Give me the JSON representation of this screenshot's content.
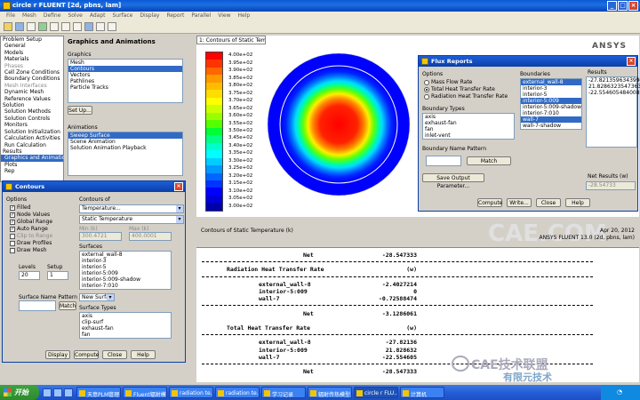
{
  "window": {
    "title": "circle r FLUENT [2d, pbns, lam]"
  },
  "menu": [
    "File",
    "Mesh",
    "Define",
    "Solve",
    "Adapt",
    "Surface",
    "Display",
    "Report",
    "Parallel",
    "View",
    "Help"
  ],
  "nav": {
    "items": [
      {
        "label": "Problem Setup",
        "type": "h"
      },
      {
        "label": "General"
      },
      {
        "label": "Models"
      },
      {
        "label": "Materials"
      },
      {
        "label": "Phases",
        "type": "dis"
      },
      {
        "label": "Cell Zone Conditions"
      },
      {
        "label": "Boundary Conditions"
      },
      {
        "label": "Mesh Interfaces",
        "type": "dis"
      },
      {
        "label": "Dynamic Mesh"
      },
      {
        "label": "Reference Values"
      },
      {
        "label": "Solution",
        "type": "h"
      },
      {
        "label": "Solution Methods"
      },
      {
        "label": "Solution Controls"
      },
      {
        "label": "Monitors"
      },
      {
        "label": "Solution Initialization"
      },
      {
        "label": "Calculation Activities"
      },
      {
        "label": "Run Calculation"
      },
      {
        "label": "Results",
        "type": "h"
      },
      {
        "label": "Graphics and Animations",
        "type": "sel"
      },
      {
        "label": "Plots"
      },
      {
        "label": "Rep"
      }
    ]
  },
  "graphics_panel": {
    "title": "Graphics and Animations",
    "graphics_label": "Graphics",
    "graphics_items": [
      "Mesh",
      "Contours",
      "Vectors",
      "Pathlines",
      "Particle Tracks"
    ],
    "graphics_selected": 1,
    "setup_button": "Set Up...",
    "animations_label": "Animations",
    "animation_items": [
      "Sweep Surface",
      "Scene Animation",
      "Solution Animation Playback"
    ],
    "animation_selected": 0
  },
  "graphics_window": {
    "tab": "1: Contours of Static Temper",
    "brand": "ANSYS",
    "scale_values": [
      "4.00e+02",
      "3.95e+02",
      "3.90e+02",
      "3.85e+02",
      "3.80e+02",
      "3.75e+02",
      "3.70e+02",
      "3.65e+02",
      "3.60e+02",
      "3.55e+02",
      "3.50e+02",
      "3.45e+02",
      "3.40e+02",
      "3.35e+02",
      "3.30e+02",
      "3.25e+02",
      "3.20e+02",
      "3.15e+02",
      "3.10e+02",
      "3.05e+02",
      "3.00e+02"
    ],
    "scale_colors": [
      "#ff0000",
      "#ff3300",
      "#ff6600",
      "#ff9900",
      "#ffbb00",
      "#ffdd00",
      "#ffff00",
      "#ccff00",
      "#99ff00",
      "#55ff00",
      "#00ff33",
      "#00ff88",
      "#00ffcc",
      "#00ffff",
      "#00ccff",
      "#0099ff",
      "#0066ff",
      "#0033ff",
      "#0000ff",
      "#0000dd",
      "#0000aa"
    ],
    "watermark": "CAE.COM",
    "caption": "Contours of Static Temperature (k)",
    "date": "Apr 20, 2012",
    "version": "ANSYS FLUENT 13.0 (2d, pbns, lam)"
  },
  "console": [
    {
      "l": "Net",
      "r": "-28.547333",
      "kind": "row"
    },
    {
      "kind": "dash"
    },
    {
      "l": "Radiation Heat Transfer Rate",
      "r": "(w)",
      "kind": "head"
    },
    {
      "kind": "dash"
    },
    {
      "l": "external_wall-8",
      "r": "-2.4027214",
      "kind": "row"
    },
    {
      "l": "interior-5:009",
      "r": "0",
      "kind": "row"
    },
    {
      "l": "wall-7",
      "r": "-0.72588474",
      "kind": "row"
    },
    {
      "kind": "dash"
    },
    {
      "l": "Net",
      "r": "-3.1286061",
      "kind": "row"
    },
    {
      "kind": "blank"
    },
    {
      "l": "Total Heat Transfer Rate",
      "r": "(w)",
      "kind": "head"
    },
    {
      "kind": "dash"
    },
    {
      "l": "external_wall-8",
      "r": "-27.82136",
      "kind": "row"
    },
    {
      "l": "interior-5:009",
      "r": "21.828632",
      "kind": "row"
    },
    {
      "l": "wall-7",
      "r": "-22.554605",
      "kind": "row"
    },
    {
      "kind": "dash"
    },
    {
      "l": "Net",
      "r": "-28.547333",
      "kind": "row"
    }
  ],
  "flux": {
    "title": "Flux Reports",
    "options_label": "Options",
    "options": [
      "Mass Flow Rate",
      "Total Heat Transfer Rate",
      "Radiation Heat Transfer Rate"
    ],
    "option_selected": 1,
    "boundary_types_label": "Boundary Types",
    "boundary_types": [
      "axis",
      "exhaust-fan",
      "fan",
      "inlet-vent"
    ],
    "boundaries_label": "Boundaries",
    "boundaries": [
      "external_wall-8",
      "interior-3",
      "interior-5",
      "interior-5:009",
      "interior-5:009-shadow",
      "interior-7:010",
      "wall-7",
      "wall-7-shadow"
    ],
    "boundaries_selected": [
      0,
      3,
      6
    ],
    "results_label": "Results",
    "results": [
      "-27.82135963439941",
      "21.82863235473633",
      "-22.55460548400879"
    ],
    "pattern_label": "Boundary Name Pattern",
    "match": "Match",
    "save_output": "Save Output Parameter...",
    "net_label": "Net Results (w)",
    "net_value": "-28.54733",
    "buttons": [
      "Compute",
      "Write...",
      "Close",
      "Help"
    ]
  },
  "contours": {
    "title": "Contours",
    "options_label": "Options",
    "options": [
      {
        "label": "Filled",
        "checked": true
      },
      {
        "label": "Node Values",
        "checked": true
      },
      {
        "label": "Global Range",
        "checked": true
      },
      {
        "label": "Auto Range",
        "checked": true
      },
      {
        "label": "Clip to Range",
        "checked": false,
        "disabled": true
      },
      {
        "label": "Draw Profiles",
        "checked": false
      },
      {
        "label": "Draw Mesh",
        "checked": false
      }
    ],
    "contours_of_label": "Contours of",
    "contours_of": "Temperature...",
    "contours_sub": "Static Temperature",
    "min_label": "Min (k)",
    "min_value": "300.4721",
    "max_label": "Max (k)",
    "max_value": "400.0001",
    "levels_label": "Levels",
    "levels": "20",
    "setup_label": "Setup",
    "setup": "1",
    "surfaces_label": "Surfaces",
    "surfaces": [
      "external_wall-8",
      "interior-3",
      "interior-5",
      "interior-5:009",
      "interior-5:009-shadow",
      "interior-7:010"
    ],
    "new_surface": "New Surface",
    "surface_types_label": "Surface Types",
    "surface_types": [
      "axis",
      "clip-surf",
      "exhaust-fan",
      "fan"
    ],
    "pattern_label": "Surface Name Pattern",
    "match": "Match",
    "buttons": [
      "Display",
      "Compute",
      "Close",
      "Help"
    ]
  },
  "taskbar": {
    "start": "开始",
    "tasks": [
      "天意PLM管理",
      "Fluent辐射模...",
      "radiation te...",
      "radiation te...",
      "学习记录",
      "辐射传热模型...",
      "circle r FLU...",
      "计算机"
    ],
    "active": 6
  },
  "watermark": {
    "line1": "CAE技术联盟",
    "line2": "有限元技术"
  }
}
